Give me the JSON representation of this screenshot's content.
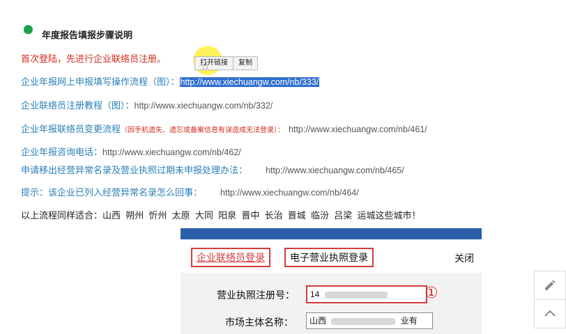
{
  "heading": "年度报告填报步骤说明",
  "first_login": "首次登陆，先进行企业联络员注册。",
  "buttons": {
    "open_link": "打开链接",
    "copy": "复制"
  },
  "items": [
    {
      "label": "企业年报网上申报填写操作流程（图）：",
      "url": "http://www.xiechuangw.com/nb/333/"
    },
    {
      "label": "企业联络员注册教程（图）：",
      "url": "http://www.xiechuangw.com/nb/332/"
    },
    {
      "label": "企业年报联络员变更流程",
      "note": "（因手机遗失、遗忘或备案信息有误造成无法登录）：",
      "url": "http://www.xiechuangw.com/nb/461/"
    },
    {
      "label": "企业年报咨询电话：",
      "url": "http://www.xiechuangw.com/nb/462/"
    },
    {
      "label": "申请移出经营异常名录及营业执照过期未申报处理办法：",
      "url": "http://www.xiechuangw.com/nb/465/"
    },
    {
      "label": "提示：该企业已列入经营异常名录怎么回事：",
      "url": "http://www.xiechuangw.com/nb/464/"
    }
  ],
  "cities_line": "以上流程同样适合：山西  朔州  忻州  太原  大同  阳泉  晋中  长治  晋城  临汾  吕梁  运城这些城市！",
  "panel": {
    "tab_liaison": "企业联络员登录",
    "tab_license": "电子营业执照登录",
    "close": "关闭",
    "reg_no_label": "营业执照注册号：",
    "reg_no_value": "14",
    "name_label": "市场主体名称：",
    "name_prefix": "山西",
    "name_suffix": "业有",
    "marker": "①"
  },
  "sidebar": {
    "edit_icon": "pencil-icon",
    "top_icon": "chevron-up-icon"
  }
}
